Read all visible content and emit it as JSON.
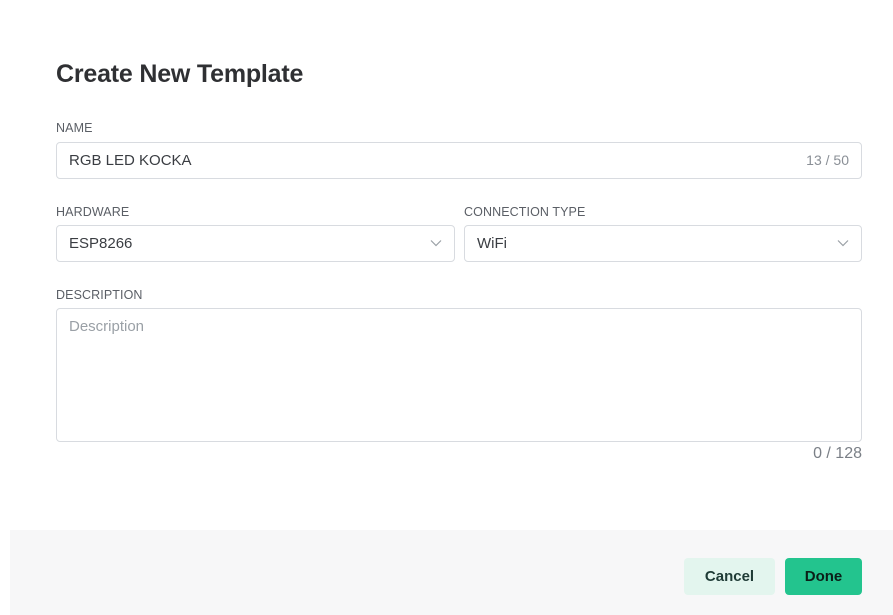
{
  "dialog": {
    "title": "Create New Template",
    "name": {
      "label": "NAME",
      "value": "RGB LED KOCKA",
      "counter": "13 / 50"
    },
    "hardware": {
      "label": "HARDWARE",
      "value": "ESP8266",
      "icon": "chevron-down-icon"
    },
    "connection_type": {
      "label": "CONNECTION TYPE",
      "value": "WiFi",
      "icon": "chevron-down-icon"
    },
    "description": {
      "label": "DESCRIPTION",
      "placeholder": "Description",
      "counter": "0 / 128"
    },
    "buttons": {
      "cancel": "Cancel",
      "done": "Done"
    },
    "colors": {
      "primary": "#23c48e",
      "secondary_bg": "#e3f5ee",
      "footer_bg": "#f7f7f8"
    }
  }
}
